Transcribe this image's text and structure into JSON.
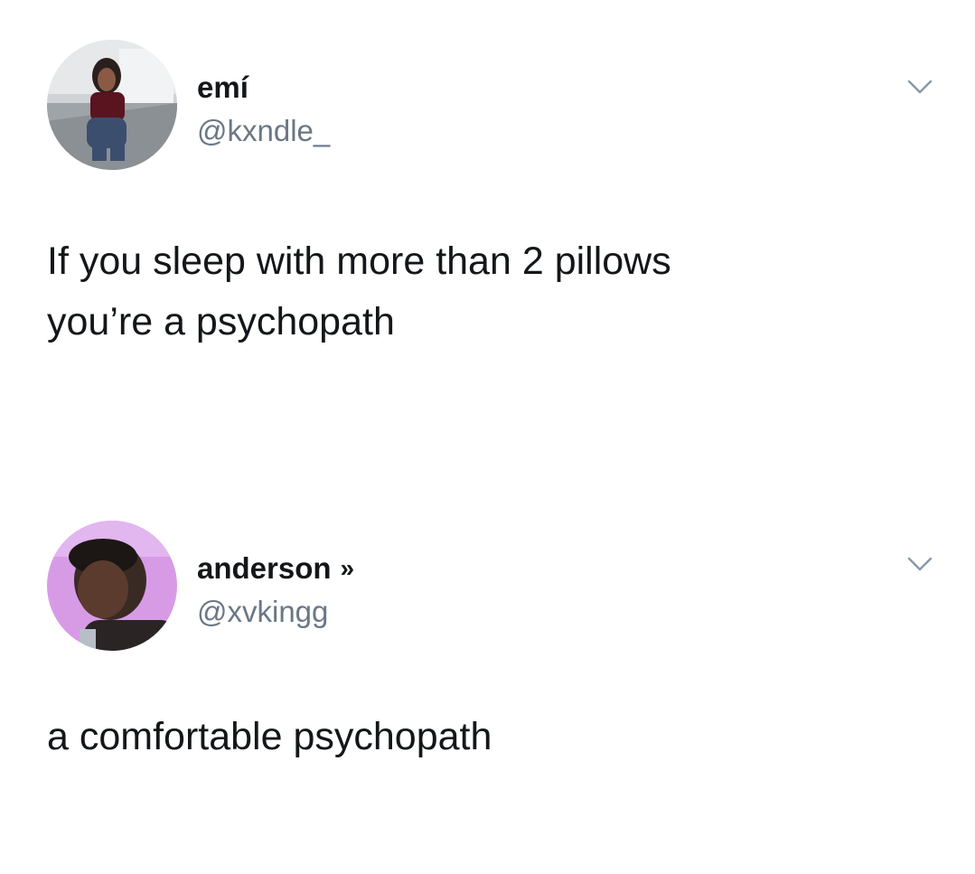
{
  "tweets": [
    {
      "display_name": "emí",
      "handle": "@kxndle_",
      "text": "If you sleep with more than 2 pillows\nyou’re a psychopath",
      "avatar_icon": "profile-photo",
      "caret_icon": "chevron-down-icon"
    },
    {
      "display_name": "anderson",
      "name_emoji": "»",
      "handle": "@xvkingg",
      "text": "a comfortable psychopath",
      "avatar_icon": "profile-photo",
      "caret_icon": "chevron-down-icon"
    }
  ],
  "colors": {
    "text_primary": "#14171a",
    "text_secondary": "#6b7785",
    "caret": "#8899a6",
    "background": "#ffffff"
  }
}
